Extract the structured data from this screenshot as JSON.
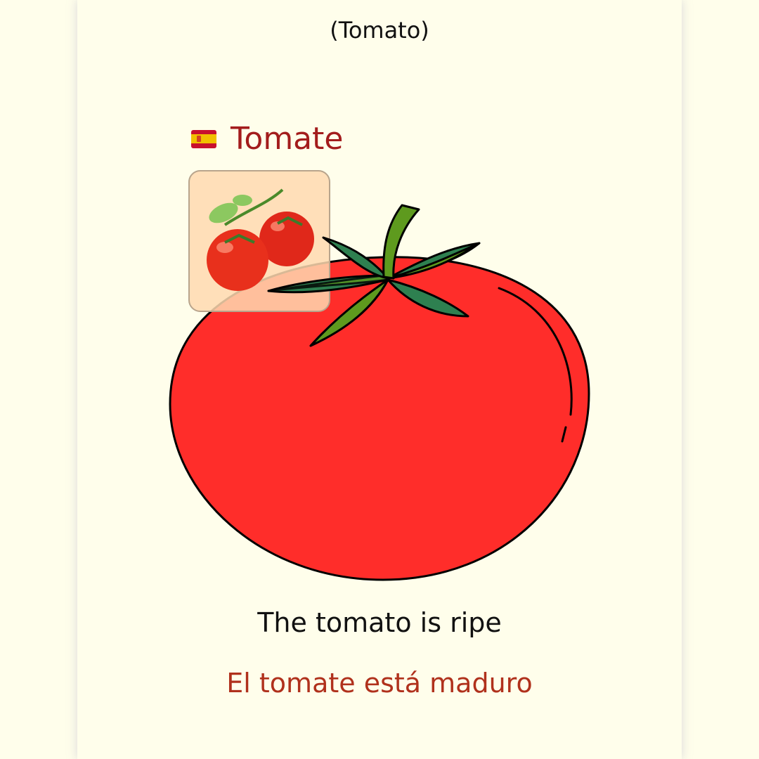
{
  "header": {
    "translation": "(Tomato)"
  },
  "word": {
    "flag_icon": "spain-flag-icon",
    "text": "Tomate"
  },
  "sentences": {
    "english": "The tomato is ripe",
    "spanish": "El tomate está maduro"
  },
  "colors": {
    "background": "#fffeeb",
    "word": "#a31c1c",
    "tomato": "#ff2d2a",
    "leaf_dark": "#2e8050",
    "leaf_light": "#5e9a1e"
  }
}
